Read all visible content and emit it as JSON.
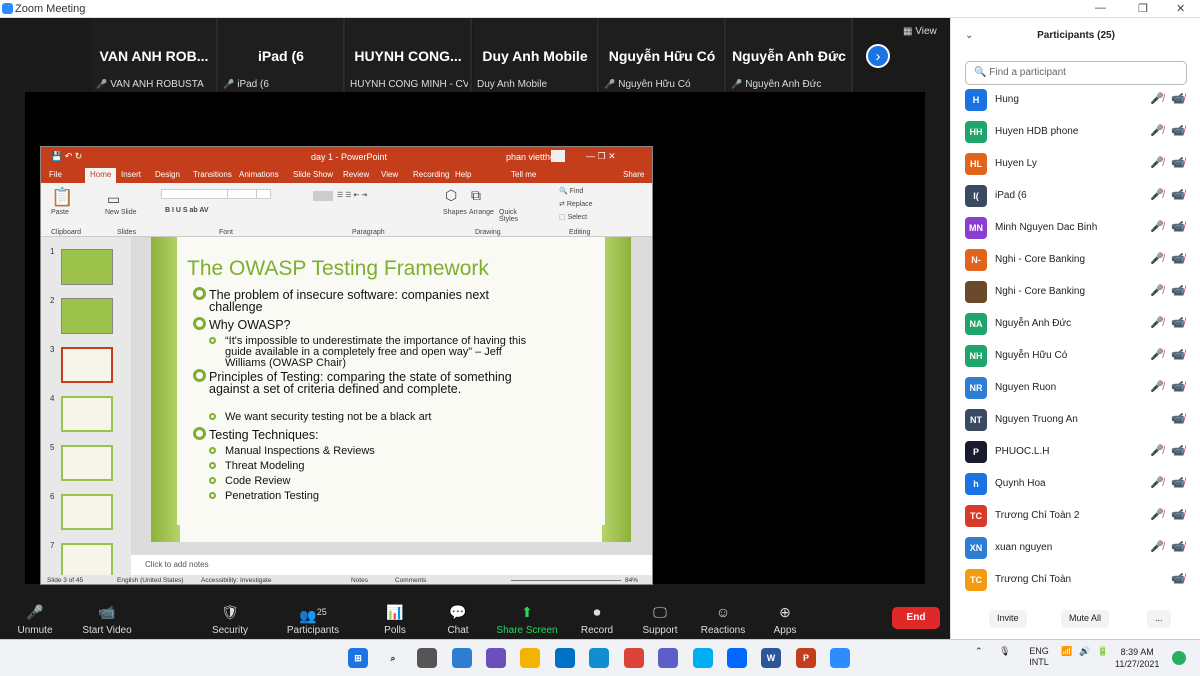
{
  "window": {
    "title": "Zoom Meeting",
    "view_label": "View"
  },
  "thumbnails": [
    {
      "name": "VAN ANH ROB...",
      "sub": "VAN ANH ROBUSTA",
      "muted": true
    },
    {
      "name": "iPad (6",
      "sub": "iPad (6",
      "muted": true
    },
    {
      "name": "HUYNH CONG...",
      "sub": "HUYNH CONG MINH - CV...",
      "muted": false
    },
    {
      "name": "Duy Anh Mobile",
      "sub": "Duy Anh Mobile",
      "muted": false
    },
    {
      "name": "Nguyễn Hữu Có",
      "sub": "Nguyễn Hữu Có",
      "muted": true
    },
    {
      "name": "Nguyễn Anh Đức",
      "sub": "Nguyễn Anh Đức",
      "muted": true
    }
  ],
  "ppt": {
    "doc_title": "day 1 - PowerPoint",
    "user": "phan vietthe",
    "tabs": [
      "File",
      "Home",
      "Insert",
      "Design",
      "Transitions",
      "Animations",
      "Slide Show",
      "Review",
      "View",
      "Recording",
      "Help",
      "Tell me",
      "Share"
    ],
    "ribbon_groups": [
      "Clipboard",
      "Slides",
      "Font",
      "Paragraph",
      "Drawing",
      "Editing"
    ],
    "ribbon_items": {
      "paste": "Paste",
      "new_slide": "New Slide",
      "shapes": "Shapes",
      "arrange": "Arrange",
      "quick_styles": "Quick Styles",
      "find": "Find",
      "replace": "Replace",
      "select": "Select"
    },
    "slide_numbers": [
      "1",
      "2",
      "3",
      "4",
      "5",
      "6",
      "7"
    ],
    "slide": {
      "title": "The OWASP Testing Framework",
      "b1": "The problem of insecure software: companies next challenge",
      "b2": "Why OWASP?",
      "b2a": "“It's impossible to underestimate the importance of having this guide available in a completely free and open way” – Jeff Williams (OWASP Chair)",
      "b3": "Principles of Testing: comparing the state of something against a set of criteria defined and complete.",
      "b3a": "We want security testing not be a black art",
      "b4": "Testing Techniques:",
      "b4a": "Manual Inspections & Reviews",
      "b4b": "Threat Modeling",
      "b4c": "Code Review",
      "b4d": "Penetration Testing"
    },
    "notes_placeholder": "Click to add notes",
    "status": {
      "slide": "Slide 3 of 45",
      "lang": "English (United States)",
      "access": "Accessibility: Investigate",
      "notes": "Notes",
      "comments": "Comments",
      "zoom": "84%"
    }
  },
  "toolbar": [
    {
      "label": "Unmute",
      "icon": "🎤"
    },
    {
      "label": "Start Video",
      "icon": "📹"
    },
    {
      "label": "Security",
      "icon": "🛡"
    },
    {
      "label": "Participants",
      "icon": "👥",
      "count": "25"
    },
    {
      "label": "Polls",
      "icon": "📊"
    },
    {
      "label": "Chat",
      "icon": "💬"
    },
    {
      "label": "Share Screen",
      "icon": "⬆"
    },
    {
      "label": "Record",
      "icon": "⏺"
    },
    {
      "label": "Support",
      "icon": "🖵"
    },
    {
      "label": "Reactions",
      "icon": "☺"
    },
    {
      "label": "Apps",
      "icon": "⊕"
    }
  ],
  "end_label": "End",
  "panel": {
    "title": "Participants (25)",
    "search_placeholder": "Find a participant",
    "invite": "Invite",
    "mute_all": "Mute All",
    "more": "..."
  },
  "participants": [
    {
      "init": "H",
      "name": "Hung",
      "color": "#1b74e4"
    },
    {
      "init": "HH",
      "name": "Huyen HDB phone",
      "color": "#1fa56b"
    },
    {
      "init": "HL",
      "name": "Huyen Ly",
      "color": "#e2631b"
    },
    {
      "init": "I(",
      "name": "iPad (6",
      "color": "#3a4a63"
    },
    {
      "init": "MN",
      "name": "Minh Nguyen Dac Binh",
      "color": "#8a3fd1"
    },
    {
      "init": "N-",
      "name": "Nghi - Core Banking",
      "color": "#e2631b"
    },
    {
      "init": "",
      "name": "Nghi - Core Banking",
      "color": "#6a4a2a"
    },
    {
      "init": "NA",
      "name": "Nguyễn Anh Đức",
      "color": "#1fa56b"
    },
    {
      "init": "NH",
      "name": "Nguyễn Hữu Có",
      "color": "#1fa56b"
    },
    {
      "init": "NR",
      "name": "Nguyen Ruon",
      "color": "#2d7dd2"
    },
    {
      "init": "NT",
      "name": "Nguyen Truong An",
      "color": "#3a4a63"
    },
    {
      "init": "P",
      "name": "PHUOC.L.H",
      "color": "#1a1a2e"
    },
    {
      "init": "h",
      "name": "Quynh Hoa",
      "color": "#1b74e4"
    },
    {
      "init": "TC",
      "name": "Trương Chí Toàn 2",
      "color": "#d93b2b"
    },
    {
      "init": "XN",
      "name": "xuan nguyen",
      "color": "#2d7dd2"
    },
    {
      "init": "TC",
      "name": "Trương Chí Toàn",
      "color": "#f39c12"
    }
  ],
  "tray": {
    "lang1": "ENG",
    "lang2": "INTL",
    "time": "8:39 AM",
    "date": "11/27/2021"
  }
}
